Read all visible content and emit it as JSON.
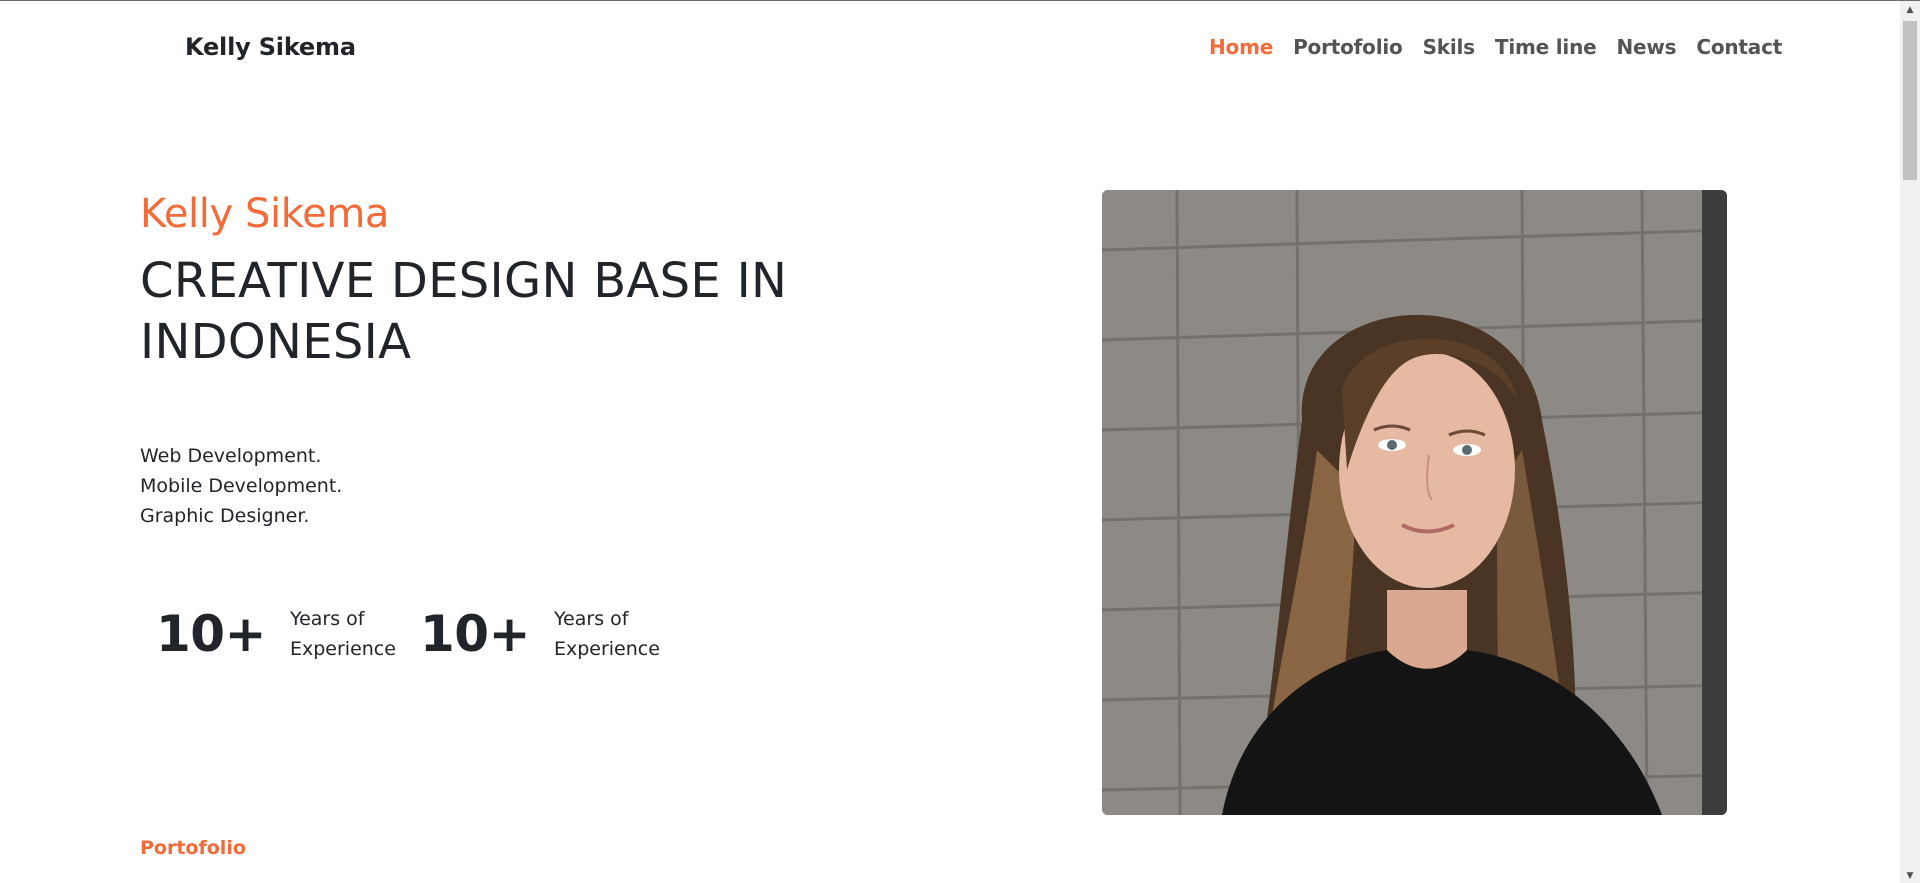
{
  "nav": {
    "brand": "Kelly Sikema",
    "items": [
      {
        "label": "Home",
        "active": true
      },
      {
        "label": "Portofolio",
        "active": false
      },
      {
        "label": "Skils",
        "active": false
      },
      {
        "label": "Time line",
        "active": false
      },
      {
        "label": "News",
        "active": false
      },
      {
        "label": "Contact",
        "active": false
      }
    ]
  },
  "hero": {
    "name": "Kelly Sikema",
    "title": "CREATIVE DESIGN BASE IN INDONESIA",
    "skills": [
      "Web Development.",
      "Mobile Development.",
      "Graphic Designer."
    ],
    "stats": [
      {
        "number": "10+",
        "label": "Years of Experience"
      },
      {
        "number": "10+",
        "label": "Years of Experience"
      }
    ],
    "photo_icon": "portrait-photo"
  },
  "next_section": {
    "label": "Portofolio"
  },
  "colors": {
    "accent": "#f26b38",
    "text": "#212529",
    "nav_text": "#545454"
  }
}
